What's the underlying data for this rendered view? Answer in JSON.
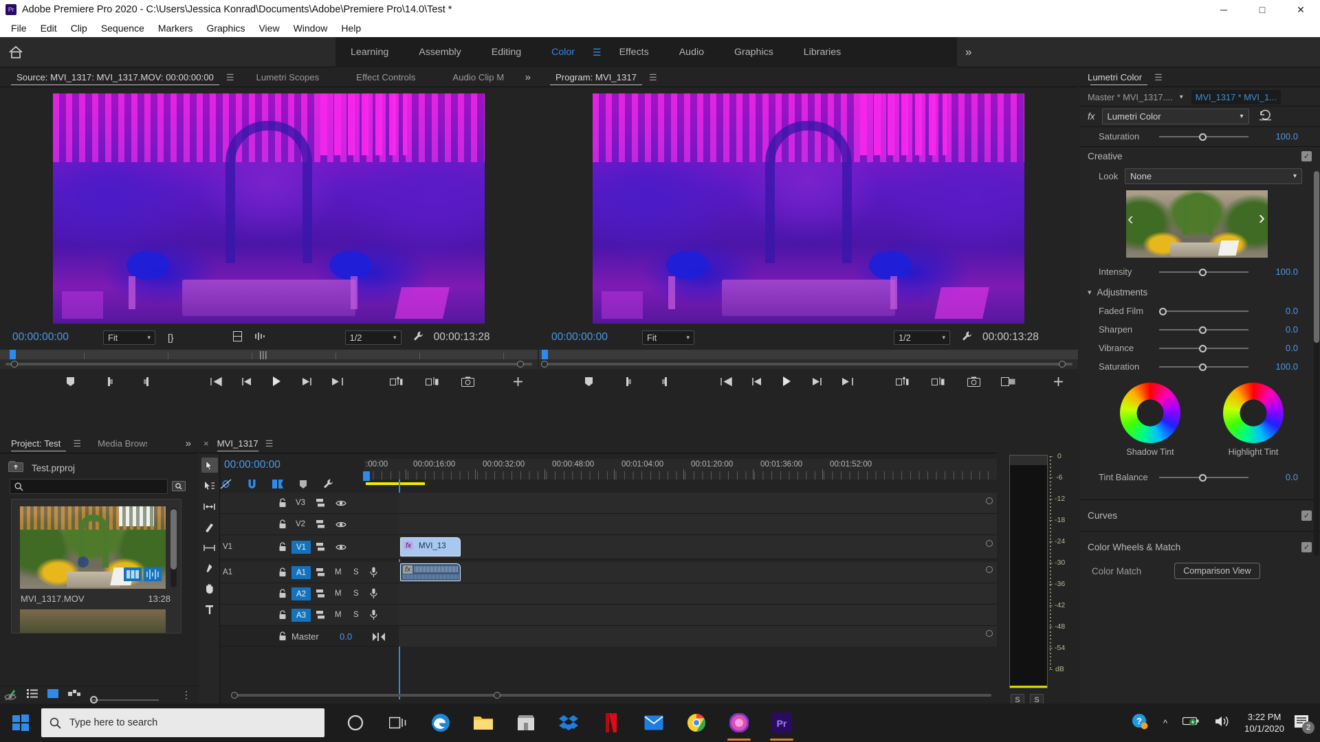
{
  "window": {
    "app_badge": "Pr",
    "title": "Adobe Premiere Pro 2020 - C:\\Users\\Jessica Konrad\\Documents\\Adobe\\Premiere Pro\\14.0\\Test *",
    "minimize": "─",
    "maximize": "□",
    "close": "✕"
  },
  "menubar": {
    "items": [
      "File",
      "Edit",
      "Clip",
      "Sequence",
      "Markers",
      "Graphics",
      "View",
      "Window",
      "Help"
    ]
  },
  "workspace": {
    "home_icon": "home-icon",
    "tabs": [
      {
        "label": "Learning",
        "active": false
      },
      {
        "label": "Assembly",
        "active": false
      },
      {
        "label": "Editing",
        "active": false
      },
      {
        "label": "Color",
        "active": true
      },
      {
        "label": "Effects",
        "active": false
      },
      {
        "label": "Audio",
        "active": false
      },
      {
        "label": "Graphics",
        "active": false
      },
      {
        "label": "Libraries",
        "active": false
      }
    ],
    "overflow": "»",
    "accent": "#2d8ceb"
  },
  "source_monitor": {
    "tabs": [
      {
        "label": "Source: MVI_1317: MVI_1317.MOV: 00:00:00:00",
        "active": true,
        "menu": true
      },
      {
        "label": "Lumetri Scopes",
        "active": false
      },
      {
        "label": "Effect Controls",
        "active": false
      },
      {
        "label": "Audio Clip M",
        "active": false
      }
    ],
    "overflow": "»",
    "current_time": "00:00:00:00",
    "fit": "Fit",
    "resolution": "1/2",
    "duration": "00:00:13:28"
  },
  "program_monitor": {
    "tabs": [
      {
        "label": "Program: MVI_1317",
        "active": true,
        "menu": true
      }
    ],
    "current_time": "00:00:00:00",
    "fit": "Fit",
    "resolution": "1/2",
    "duration": "00:00:13:28"
  },
  "project_panel": {
    "tabs": [
      {
        "label": "Project: Test",
        "active": true,
        "menu": true
      },
      {
        "label": "Media Browse",
        "active": false
      }
    ],
    "overflow": "»",
    "project_file": "Test.prproj",
    "search_placeholder": "",
    "items": [
      {
        "name": "MVI_1317.MOV",
        "duration": "13:28"
      }
    ]
  },
  "timeline": {
    "tabs": [
      {
        "label": "MVI_1317",
        "active": true,
        "menu": true,
        "close": "×"
      }
    ],
    "playhead_time": "00:00:00:00",
    "ruler_labels": [
      ":00:00",
      "00:00:16:00",
      "00:00:32:00",
      "00:00:48:00",
      "00:01:04:00",
      "00:01:20:00",
      "00:01:36:00",
      "00:01:52:00"
    ],
    "tools": [
      "selection-tool",
      "track-select-forward-tool",
      "ripple-edit-tool",
      "razor-tool",
      "slip-tool",
      "pen-tool",
      "hand-tool",
      "type-tool"
    ],
    "header_buttons": [
      "linked-selection-icon",
      "snap-icon",
      "marker-sync-icon",
      "marker-icon",
      "wrench-icon"
    ],
    "video_tracks": [
      {
        "name": "V3",
        "source_patch": "",
        "targeted": false
      },
      {
        "name": "V2",
        "source_patch": "",
        "targeted": false
      },
      {
        "name": "V1",
        "source_patch": "V1",
        "targeted": true
      }
    ],
    "audio_tracks": [
      {
        "name": "A1",
        "source_patch": "A1",
        "targeted": true,
        "mute": "M",
        "solo": "S"
      },
      {
        "name": "A2",
        "source_patch": "",
        "targeted": true,
        "mute": "M",
        "solo": "S"
      },
      {
        "name": "A3",
        "source_patch": "",
        "targeted": true,
        "mute": "M",
        "solo": "S"
      }
    ],
    "master_track": {
      "name": "Master",
      "level": "0.0"
    },
    "clips": [
      {
        "track": "V1",
        "label": "MVI_13",
        "fx_badge": "fx"
      },
      {
        "track": "A1",
        "label": "",
        "fx_badge": "fx"
      }
    ]
  },
  "audio_meters": {
    "scale": [
      "0",
      "-6",
      "-12",
      "-18",
      "-24",
      "-30",
      "-36",
      "-42",
      "-48",
      "-54",
      "dB"
    ],
    "solo_buttons": [
      "S",
      "S"
    ]
  },
  "lumetri": {
    "tabs": [
      {
        "label": "Lumetri Color",
        "active": true,
        "menu": true
      }
    ],
    "master_clip": "Master * MVI_1317....",
    "clip_name": "MVI_1317 * MVI_1...",
    "fx_label": "fx",
    "effect_name": "Lumetri Color",
    "reset_icon": "reset-icon",
    "basic_saturation": {
      "label": "Saturation",
      "value": "100.0",
      "pos": 50
    },
    "creative": {
      "title": "Creative",
      "enabled": true,
      "look_label": "Look",
      "look_value": "None",
      "intensity": {
        "label": "Intensity",
        "value": "100.0",
        "pos": 50
      },
      "prev_arrow": "‹",
      "next_arrow": "›"
    },
    "adjustments": {
      "title": "Adjustments",
      "sliders": [
        {
          "label": "Faded Film",
          "value": "0.0",
          "pos": 0
        },
        {
          "label": "Sharpen",
          "value": "0.0",
          "pos": 50
        },
        {
          "label": "Vibrance",
          "value": "0.0",
          "pos": 50
        },
        {
          "label": "Saturation",
          "value": "100.0",
          "pos": 50
        }
      ],
      "wheels": [
        {
          "label": "Shadow Tint"
        },
        {
          "label": "Highlight Tint"
        }
      ],
      "tint_balance": {
        "label": "Tint Balance",
        "value": "0.0",
        "pos": 50
      }
    },
    "sections": [
      {
        "title": "Curves",
        "enabled": true
      },
      {
        "title": "Color Wheels & Match",
        "enabled": true
      }
    ],
    "color_match": {
      "label": "Color Match",
      "button": "Comparison View"
    },
    "accent": "#4a9ae8"
  },
  "taskbar": {
    "start_icon": "windows-start-icon",
    "search_placeholder": "Type here to search",
    "icons": [
      "cortana-icon",
      "task-view-icon",
      "edge-icon",
      "file-explorer-icon",
      "store-icon",
      "dropbox-icon",
      "netflix-icon",
      "mail-icon",
      "chrome-icon",
      "photos-icon",
      "premiere-icon"
    ],
    "tray": [
      "help-icon",
      "chevron-up-icon",
      "battery-icon",
      "volume-icon"
    ],
    "time": "3:22 PM",
    "date": "10/1/2020",
    "notification_count": "2"
  }
}
